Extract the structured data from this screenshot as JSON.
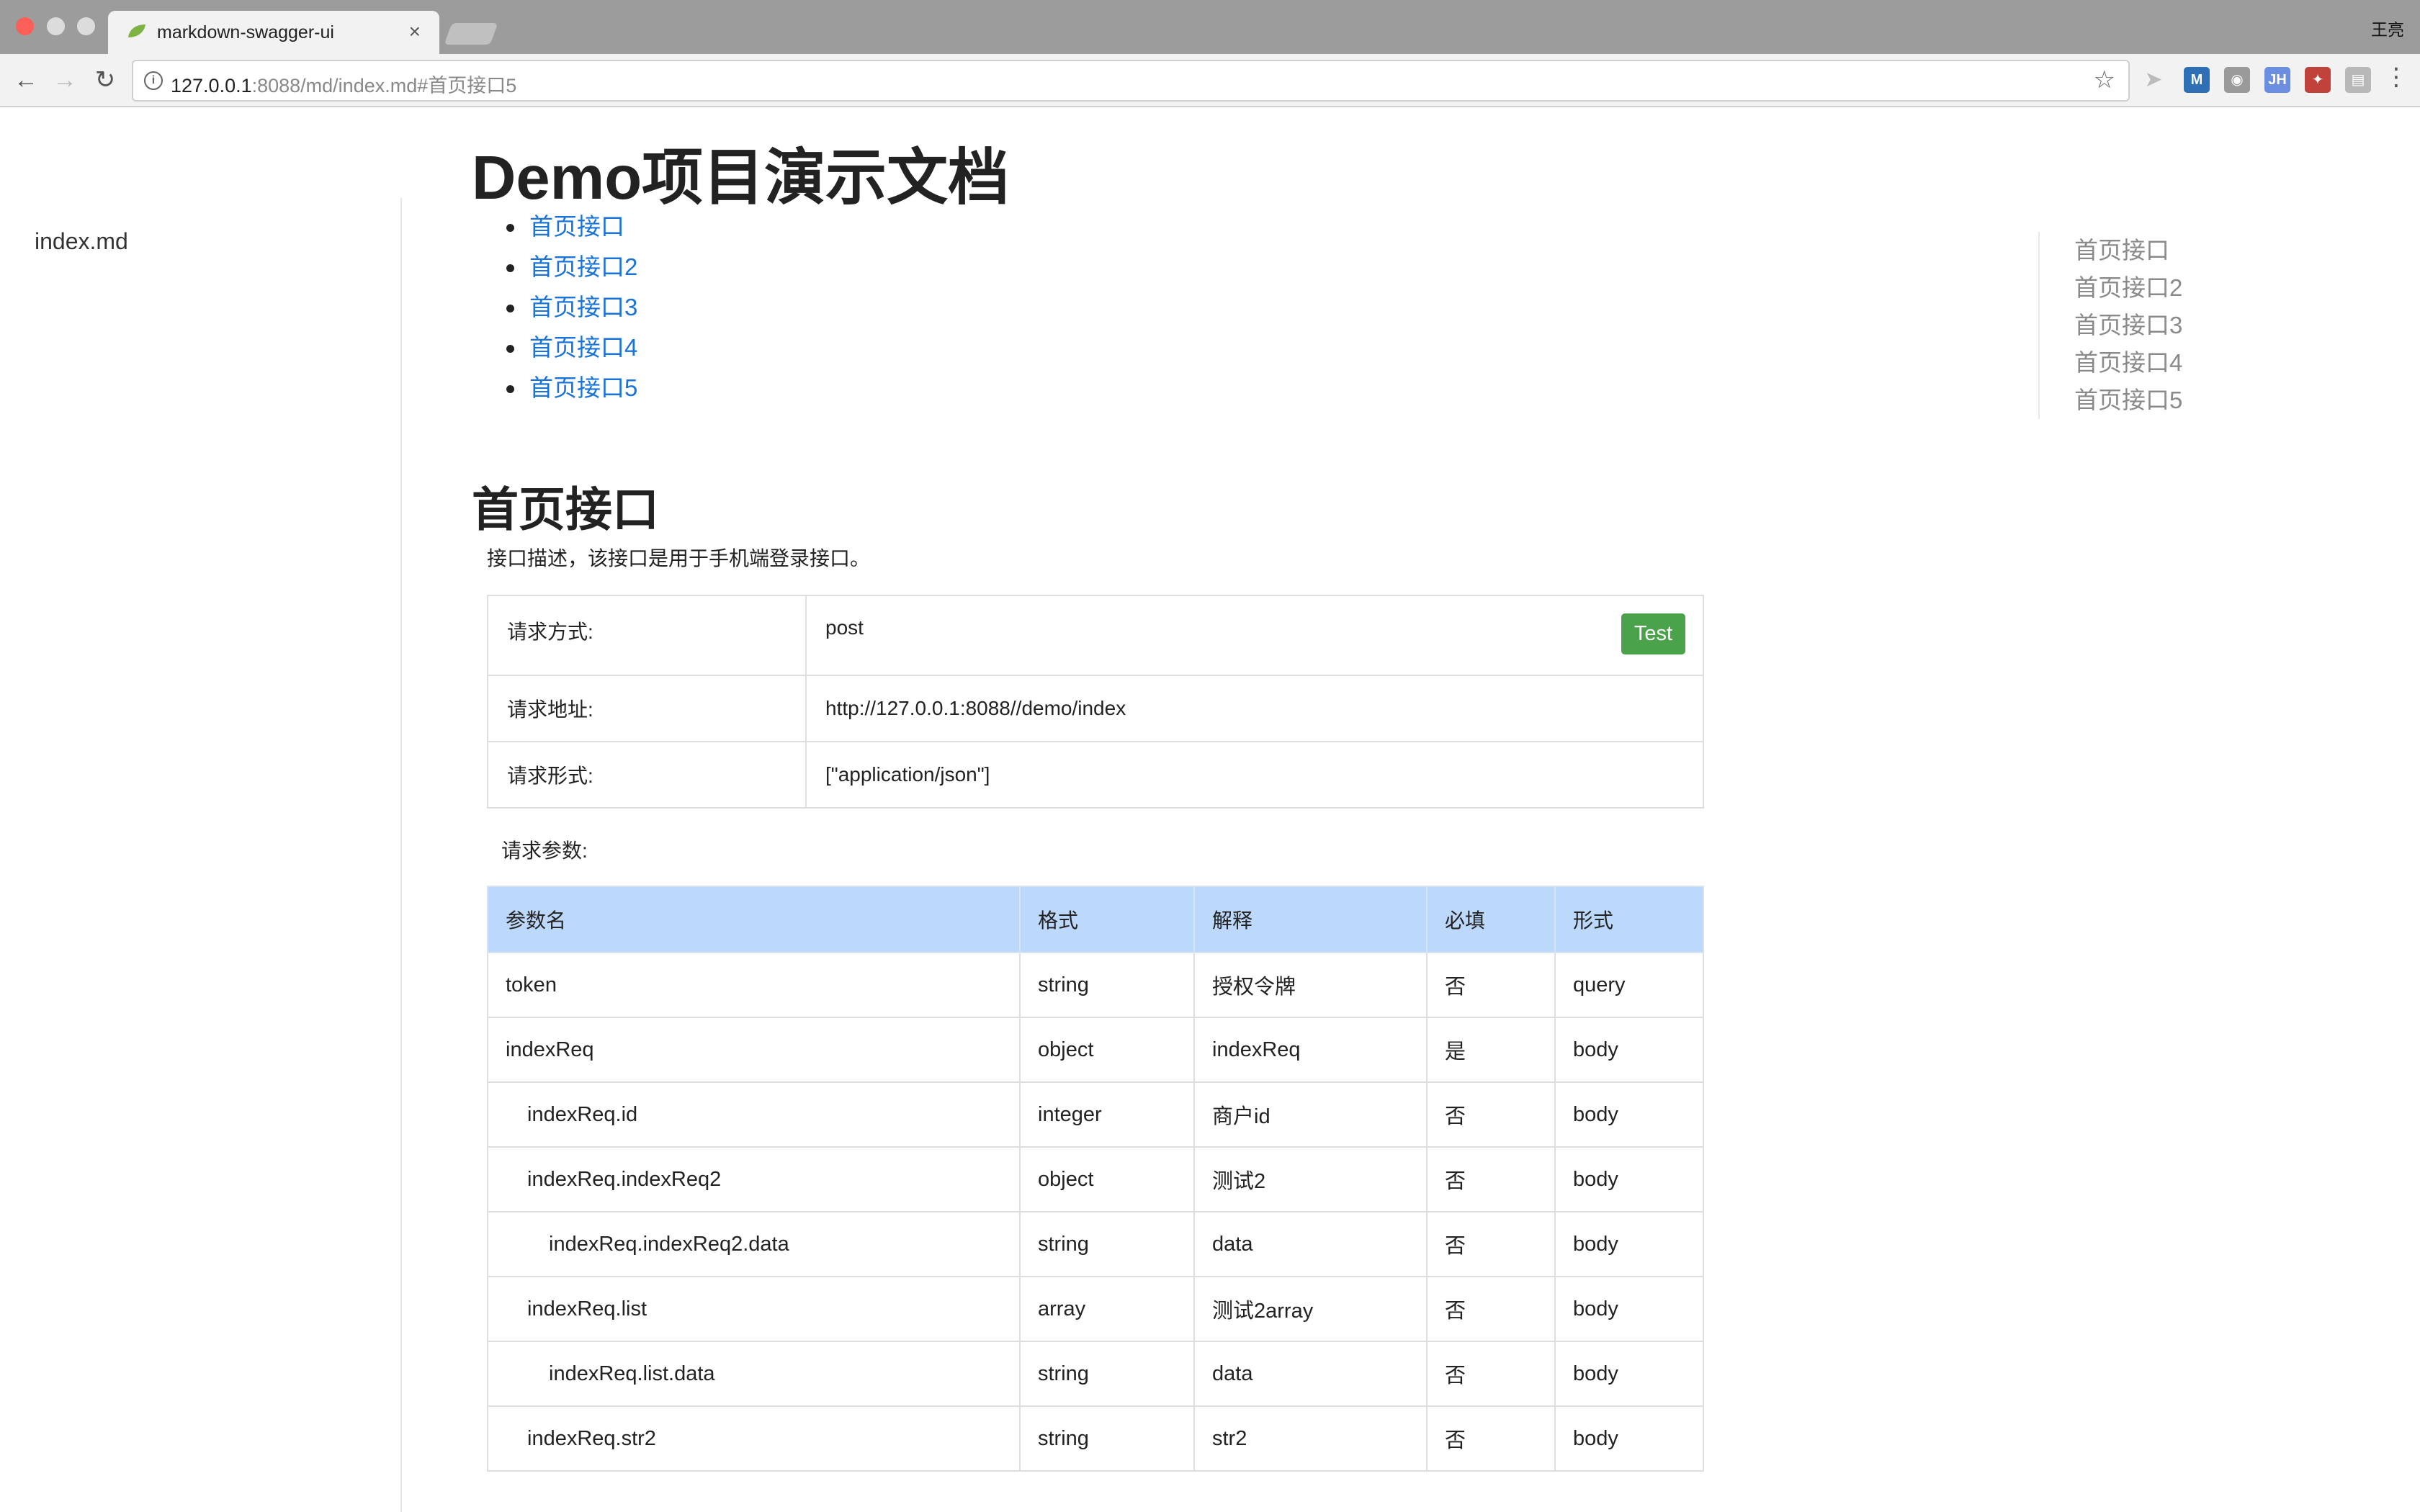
{
  "browser": {
    "tab_title": "markdown-swagger-ui",
    "tab_close": "×",
    "profile_name": "王亮",
    "url_host": "127.0.0.1",
    "url_rest": ":8088/md/index.md#首页接口5",
    "extensions": [
      {
        "icon": "M",
        "color": "#2f6fb5"
      },
      {
        "icon": "◉",
        "color": "#9a9a9a"
      },
      {
        "icon": "JH",
        "color": "#6b8ee0"
      },
      {
        "icon": "✦",
        "color": "#c0423a"
      },
      {
        "icon": "▤",
        "color": "#b8b8b8"
      }
    ]
  },
  "sidebar": {
    "file": "index.md"
  },
  "page": {
    "title": "Demo项目演示文档",
    "toc": [
      "首页接口",
      "首页接口2",
      "首页接口3",
      "首页接口4",
      "首页接口5"
    ],
    "right_toc": [
      "首页接口",
      "首页接口2",
      "首页接口3",
      "首页接口4",
      "首页接口5"
    ],
    "section": {
      "title": "首页接口",
      "description": "接口描述，该接口是用于手机端登录接口。",
      "info": [
        {
          "key": "请求方式:",
          "value": "post"
        },
        {
          "key": "请求地址:",
          "value": "http://127.0.0.1:8088//demo/index"
        },
        {
          "key": "请求形式:",
          "value": "[\"application/json\"]"
        }
      ],
      "test_button": "Test",
      "params_label": "请求参数:",
      "param_headers": [
        "参数名",
        "格式",
        "解释",
        "必填",
        "形式"
      ],
      "params": [
        {
          "name": "token",
          "format": "string",
          "desc": "授权令牌",
          "required": "否",
          "in": "query"
        },
        {
          "name": "indexReq",
          "format": "object",
          "desc": "indexReq",
          "required": "是",
          "in": "body"
        },
        {
          "name": "indexReq.id",
          "format": "integer",
          "desc": "商户id",
          "required": "否",
          "in": "body"
        },
        {
          "name": "indexReq.indexReq2",
          "format": "object",
          "desc": "测试2",
          "required": "否",
          "in": "body"
        },
        {
          "name": "indexReq.indexReq2.data",
          "format": "string",
          "desc": "data",
          "required": "否",
          "in": "body"
        },
        {
          "name": "indexReq.list",
          "format": "array",
          "desc": "测试2array",
          "required": "否",
          "in": "body"
        },
        {
          "name": "indexReq.list.data",
          "format": "string",
          "desc": "data",
          "required": "否",
          "in": "body"
        },
        {
          "name": "indexReq.str2",
          "format": "string",
          "desc": "str2",
          "required": "否",
          "in": "body"
        }
      ]
    }
  }
}
